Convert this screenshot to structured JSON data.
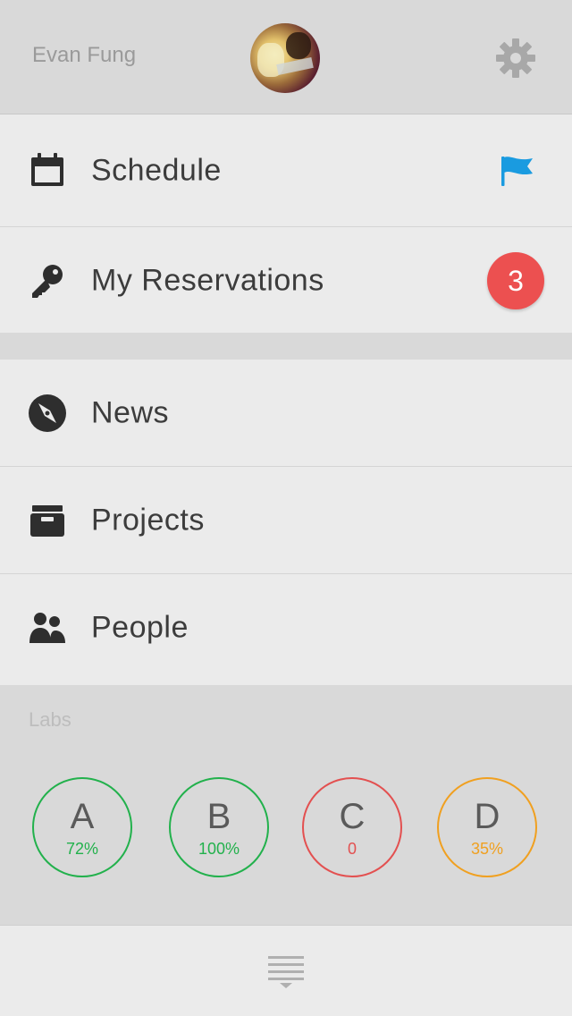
{
  "header": {
    "user_name": "Evan Fung",
    "avatar_icon": "avatar-photo",
    "settings_icon": "gear-icon"
  },
  "menu_top": {
    "items": [
      {
        "label": "Schedule",
        "icon": "calendar-icon",
        "accessory": "flag-icon"
      },
      {
        "label": "My Reservations",
        "icon": "key-icon",
        "badge": "3"
      }
    ]
  },
  "menu_main": {
    "items": [
      {
        "label": "News",
        "icon": "compass-icon"
      },
      {
        "label": "Projects",
        "icon": "archive-box-icon"
      },
      {
        "label": "People",
        "icon": "people-icon"
      }
    ]
  },
  "labs": {
    "title": "Labs",
    "items": [
      {
        "letter": "A",
        "value": "72%",
        "color": "#22b14c"
      },
      {
        "letter": "B",
        "value": "100%",
        "color": "#22b14c"
      },
      {
        "letter": "C",
        "value": "0",
        "color": "#e35050"
      },
      {
        "letter": "D",
        "value": "35%",
        "color": "#f0a020"
      }
    ]
  },
  "footer": {
    "icon": "list-toggle-icon"
  },
  "colors": {
    "accent_blue": "#1a9be0",
    "badge_red": "#ec5050",
    "status_green": "#22b14c",
    "status_red": "#e35050",
    "status_orange": "#f0a020"
  }
}
